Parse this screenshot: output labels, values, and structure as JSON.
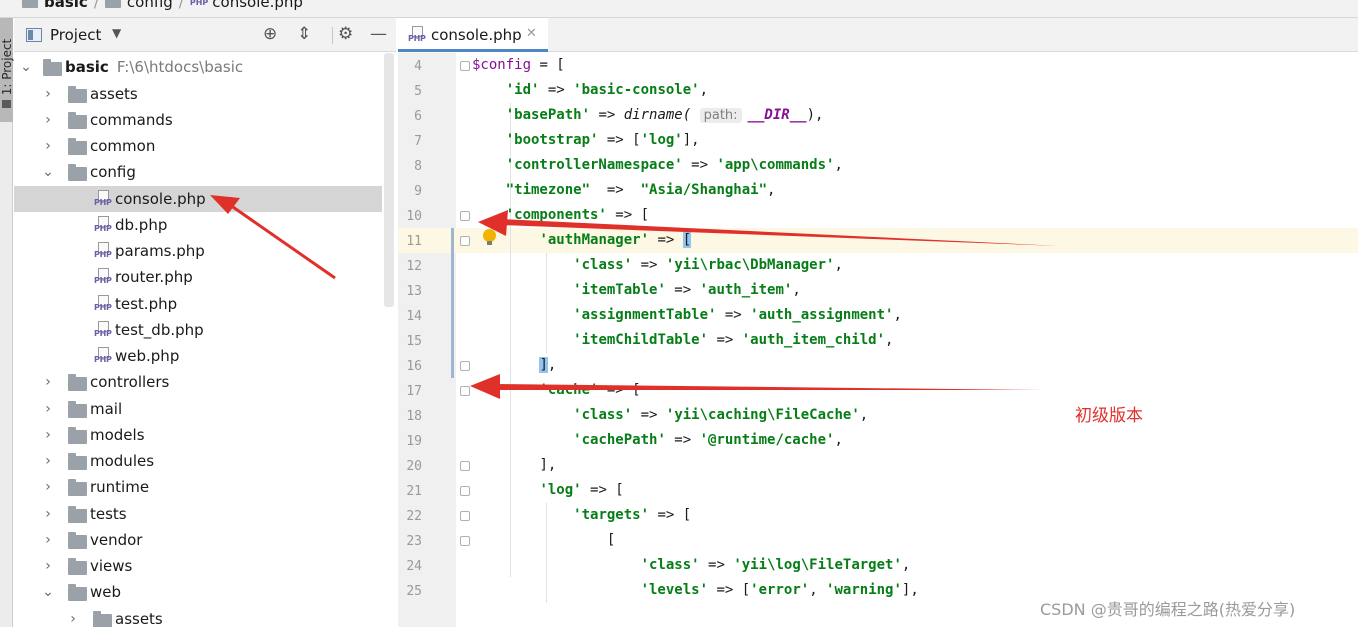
{
  "breadcrumb": {
    "items": [
      "basic",
      "config",
      "console.php"
    ]
  },
  "side_stripe": {
    "label": "1: Project"
  },
  "project_panel": {
    "title": "Project",
    "tree": [
      {
        "label": "basic",
        "path": "F:\\6\\htdocs\\basic",
        "type": "folder",
        "expanded": true
      },
      {
        "label": "assets",
        "type": "folder",
        "expanded": false
      },
      {
        "label": "commands",
        "type": "folder",
        "expanded": false
      },
      {
        "label": "common",
        "type": "folder",
        "expanded": false
      },
      {
        "label": "config",
        "type": "folder",
        "expanded": true
      },
      {
        "label": "console.php",
        "type": "php",
        "selected": true
      },
      {
        "label": "db.php",
        "type": "php"
      },
      {
        "label": "params.php",
        "type": "php"
      },
      {
        "label": "router.php",
        "type": "php"
      },
      {
        "label": "test.php",
        "type": "php"
      },
      {
        "label": "test_db.php",
        "type": "php"
      },
      {
        "label": "web.php",
        "type": "php"
      },
      {
        "label": "controllers",
        "type": "folder",
        "expanded": false
      },
      {
        "label": "mail",
        "type": "folder",
        "expanded": false
      },
      {
        "label": "models",
        "type": "folder",
        "expanded": false
      },
      {
        "label": "modules",
        "type": "folder",
        "expanded": false
      },
      {
        "label": "runtime",
        "type": "folder",
        "expanded": false
      },
      {
        "label": "tests",
        "type": "folder",
        "expanded": false
      },
      {
        "label": "vendor",
        "type": "folder",
        "expanded": false
      },
      {
        "label": "views",
        "type": "folder",
        "expanded": false
      },
      {
        "label": "web",
        "type": "folder",
        "expanded": true
      },
      {
        "label": "assets",
        "type": "folder",
        "expanded": false
      }
    ]
  },
  "editor": {
    "tab_label": "console.php",
    "file_icon_tag": "PHP",
    "current_line": 11,
    "lines": [
      {
        "no": "4"
      },
      {
        "no": "5"
      },
      {
        "no": "6"
      },
      {
        "no": "7"
      },
      {
        "no": "8"
      },
      {
        "no": "9"
      },
      {
        "no": "10"
      },
      {
        "no": "11"
      },
      {
        "no": "12"
      },
      {
        "no": "13"
      },
      {
        "no": "14"
      },
      {
        "no": "15"
      },
      {
        "no": "16"
      },
      {
        "no": "17"
      },
      {
        "no": "18"
      },
      {
        "no": "19"
      },
      {
        "no": "20"
      },
      {
        "no": "21"
      },
      {
        "no": "22"
      },
      {
        "no": "23"
      },
      {
        "no": "24"
      },
      {
        "no": "25"
      }
    ],
    "code": {
      "l4_var": "$config",
      "l4_rest": " = [",
      "l5_key": "'id'",
      "l5_op": " => ",
      "l5_val": "'basic-console'",
      "l5_end": ",",
      "l6_key": "'basePath'",
      "l6_op": " => ",
      "l6_fn": "dirname(",
      "l6_hint": "path:",
      "l6_const": "__DIR__",
      "l6_end": "),",
      "l7_key": "'bootstrap'",
      "l7_op": " => [",
      "l7_val": "'log'",
      "l7_end": "],",
      "l8_key": "'controllerNamespace'",
      "l8_op": " => ",
      "l8_val": "'app\\commands'",
      "l8_end": ",",
      "l9_key": "\"timezone\"",
      "l9_op": "  =>  ",
      "l9_val": "\"Asia/Shanghai\"",
      "l9_end": ",",
      "l10_key": "'components'",
      "l10_op": " => [",
      "l11_key": "'authManager'",
      "l11_op": " => ",
      "l11_br": "[",
      "l12_key": "'class'",
      "l12_op": " => ",
      "l12_val": "'yii\\rbac\\DbManager'",
      "l12_end": ",",
      "l13_key": "'itemTable'",
      "l13_op": " => ",
      "l13_val": "'auth_item'",
      "l13_end": ",",
      "l14_key": "'assignmentTable'",
      "l14_op": " => ",
      "l14_val": "'auth_assignment'",
      "l14_end": ",",
      "l15_key": "'itemChildTable'",
      "l15_op": " => ",
      "l15_val": "'auth_item_child'",
      "l15_end": ",",
      "l16_br": "]",
      "l16_end": ",",
      "l17_key": "'cache'",
      "l17_op": " => [",
      "l18_key": "'class'",
      "l18_op": " => ",
      "l18_val": "'yii\\caching\\FileCache'",
      "l18_end": ",",
      "l19_key": "'cachePath'",
      "l19_op": " => ",
      "l19_val": "'@runtime/cache'",
      "l19_end": ",",
      "l20": "],",
      "l21_key": "'log'",
      "l21_op": " => [",
      "l22_key": "'targets'",
      "l22_op": " => [",
      "l23": "[",
      "l24_key": "'class'",
      "l24_op": " => ",
      "l24_val": "'yii\\log\\FileTarget'",
      "l24_end": ",",
      "l25_key": "'levels'",
      "l25_op": " => [",
      "l25_v1": "'error'",
      "l25_sep": ", ",
      "l25_v2": "'warning'",
      "l25_end": "],"
    }
  },
  "annotation": {
    "note": "初级版本",
    "arrow_color": "#e0302a"
  },
  "watermark": "CSDN @贵哥的编程之路(热爱分享)",
  "colors": {
    "string": "#067d17",
    "variable": "#871094",
    "selection": "#d5d5d5",
    "current_line": "#fcf8e3",
    "tab_underline": "#4f86c6"
  }
}
